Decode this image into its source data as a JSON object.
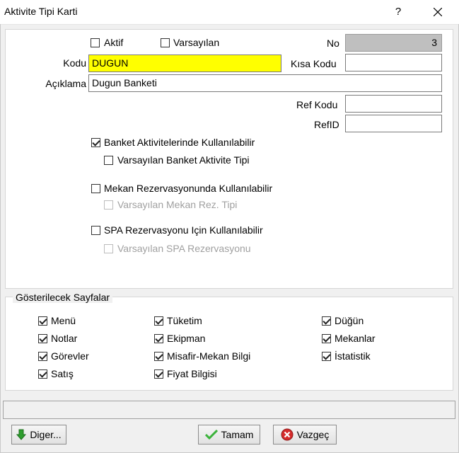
{
  "window": {
    "title": "Aktivite Tipi Karti",
    "help": "?"
  },
  "form": {
    "aktif_label": "Aktif",
    "varsayilan_label": "Varsayılan",
    "no_label": "No",
    "no_value": "3",
    "kodu_label": "Kodu",
    "kodu_value": "DUGUN",
    "kisa_kodu_label": "Kısa Kodu",
    "kisa_kodu_value": "",
    "aciklama_label": "Açıklama",
    "aciklama_value": "Dugun Banketi",
    "ref_kodu_label": "Ref Kodu",
    "ref_kodu_value": "",
    "refid_label": "RefID",
    "refid_value": ""
  },
  "options": {
    "banket": "Banket Aktivitelerinde Kullanılabilir",
    "banket_default": "Varsayılan Banket Aktivite Tipi",
    "mekan": "Mekan Rezervasyonunda Kullanılabilir",
    "mekan_default": "Varsayılan Mekan Rez. Tipi",
    "spa": "SPA Rezervasyonu Için Kullanılabilir",
    "spa_default": "Varsayılan SPA Rezervasyonu"
  },
  "pages": {
    "title": "Gösterilecek Sayfalar",
    "col1": [
      "Menü",
      "Notlar",
      "Görevler",
      "Satış"
    ],
    "col2": [
      "Tüketim",
      "Ekipman",
      "Misafir-Mekan Bilgi",
      "Fiyat Bilgisi"
    ],
    "col3": [
      "Düğün",
      "Mekanlar",
      "İstatistik"
    ]
  },
  "buttons": {
    "diger": "Diger...",
    "tamam": "Tamam",
    "vazgec": "Vazgeç"
  }
}
